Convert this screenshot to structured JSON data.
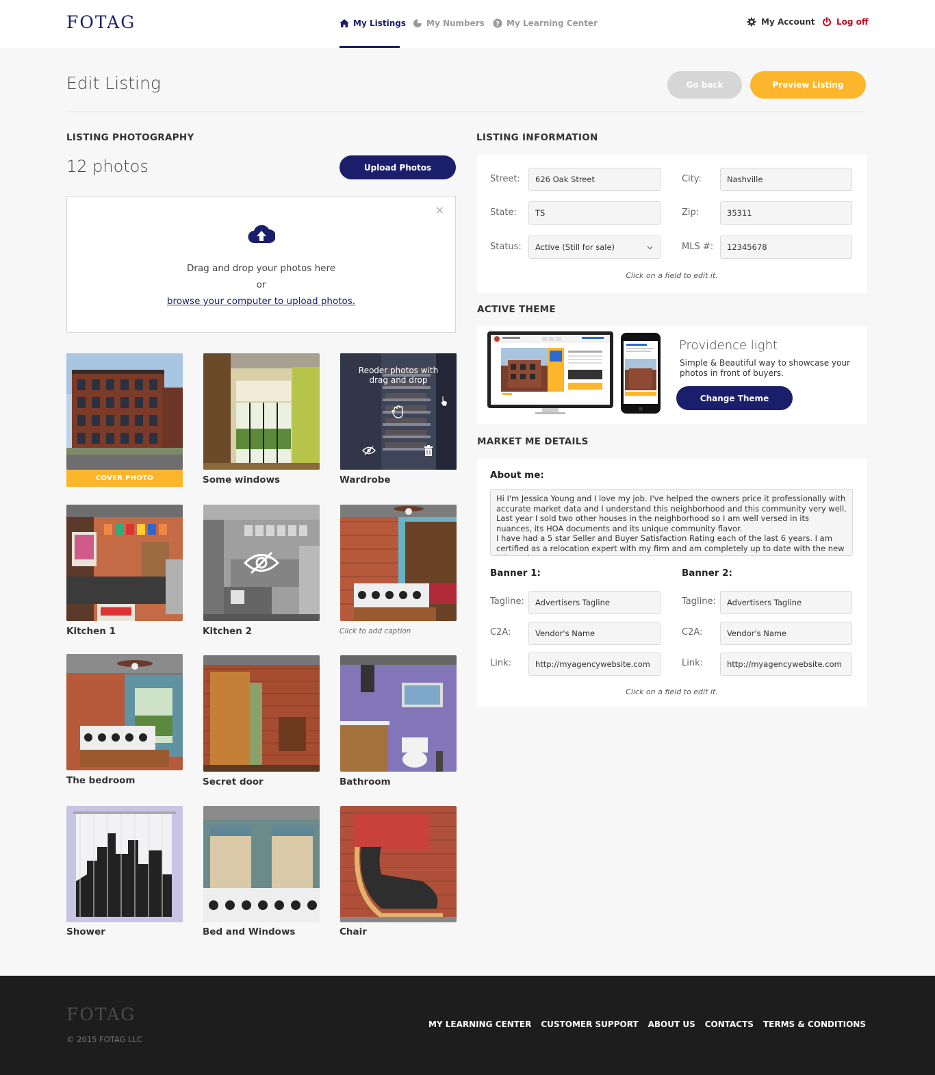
{
  "header": {
    "logo": "FOTAG",
    "nav": [
      {
        "label": "My Listings",
        "icon": "home-icon",
        "active": true
      },
      {
        "label": "My Numbers",
        "icon": "pie-chart-icon",
        "active": false
      },
      {
        "label": "My Learning Center",
        "icon": "help-circle-icon",
        "active": false
      }
    ],
    "account_label": "My Account",
    "logoff_label": "Log off"
  },
  "page": {
    "title": "Edit Listing",
    "go_back_label": "Go back",
    "preview_label": "Preview Listing"
  },
  "photos": {
    "section_title": "LISTING PHOTOGRAPHY",
    "count_label": "12 photos",
    "upload_label": "Upload Photos",
    "dropzone": {
      "line1": "Drag and drop your photos here",
      "line2": "or",
      "link": "browse your computer to upload photos."
    },
    "cover_label": "COVER PHOTO",
    "reorder_hint": "Reoder photos with drag and drop",
    "items": [
      {
        "caption": "",
        "scene": "building"
      },
      {
        "caption": "Some windows",
        "scene": "windows"
      },
      {
        "caption": "Wardrobe",
        "scene": "wardrobe"
      },
      {
        "caption": "Kitchen 1",
        "scene": "kitchen"
      },
      {
        "caption": "Kitchen 2",
        "scene": "kitchen-gray"
      },
      {
        "caption": "Click to add caption",
        "scene": "bedroom-curtain"
      },
      {
        "caption": "The bedroom",
        "scene": "bedroom"
      },
      {
        "caption": "Secret door",
        "scene": "door"
      },
      {
        "caption": "Bathroom",
        "scene": "bathroom"
      },
      {
        "caption": "Shower",
        "scene": "shower"
      },
      {
        "caption": "Bed and Windows",
        "scene": "bed-windows"
      },
      {
        "caption": "Chair",
        "scene": "chair"
      }
    ]
  },
  "listing_info": {
    "section_title": "LISTING INFORMATION",
    "street_label": "Street:",
    "street_value": "626 Oak Street",
    "city_label": "City:",
    "city_value": "Nashville",
    "state_label": "State:",
    "state_value": "TS",
    "zip_label": "Zip:",
    "zip_value": "35311",
    "status_label": "Status:",
    "status_value": "Active (Still for sale)",
    "mls_label": "MLS #:",
    "mls_value": "12345678",
    "hint": "Click on a field to edit it."
  },
  "theme": {
    "section_title": "ACTIVE THEME",
    "name": "Providence light",
    "description": "Simple & Beautiful way to showcase your photos in front of buyers.",
    "change_label": "Change Theme"
  },
  "market": {
    "section_title": "MARKET ME DETAILS",
    "about_label": "About me:",
    "about_text": "Hi I'm Jessica Young and I love my job. I've helped the owners price it professionally with accurate market data and I understand this neighborhood and this community very well. Last year I sold two other houses in the neighborhood so I am well versed in its nuances, its HOA documents and its unique community flavor.\nI have had a 5 star Seller and Buyer Satisfaction Rating each of the last 6 years. I am certified as a relocation expert with my firm and am completely up to date with the new NC purchase",
    "banner1": {
      "title": "Banner 1:",
      "tagline_label": "Tagline:",
      "tagline": "Advertisers Tagline",
      "c2a_label": "C2A:",
      "c2a": "Vendor's Name",
      "link_label": "Link:",
      "link": "http://myagencywebsite.com"
    },
    "banner2": {
      "title": "Banner 2:",
      "tagline_label": "Tagline:",
      "tagline": "Advertisers Tagline",
      "c2a_label": "C2A:",
      "c2a": "Vendor's Name",
      "link_label": "Link:",
      "link": "http://myagencywebsite.com"
    },
    "hint": "Click on a field to edit it."
  },
  "footer": {
    "logo": "FOTAG",
    "copyright": "© 2015 FOTAG LLC",
    "links": [
      "MY LEARNING CENTER",
      "CUSTOMER SUPPORT",
      "ABOUT US",
      "CONTACTS",
      "TERMS & CONDITIONS"
    ]
  },
  "colors": {
    "brand_navy": "#1b1f6b",
    "accent_orange": "#fdb52c",
    "logoff_red": "#d0021b",
    "footer_bg": "#1d1d1d"
  }
}
